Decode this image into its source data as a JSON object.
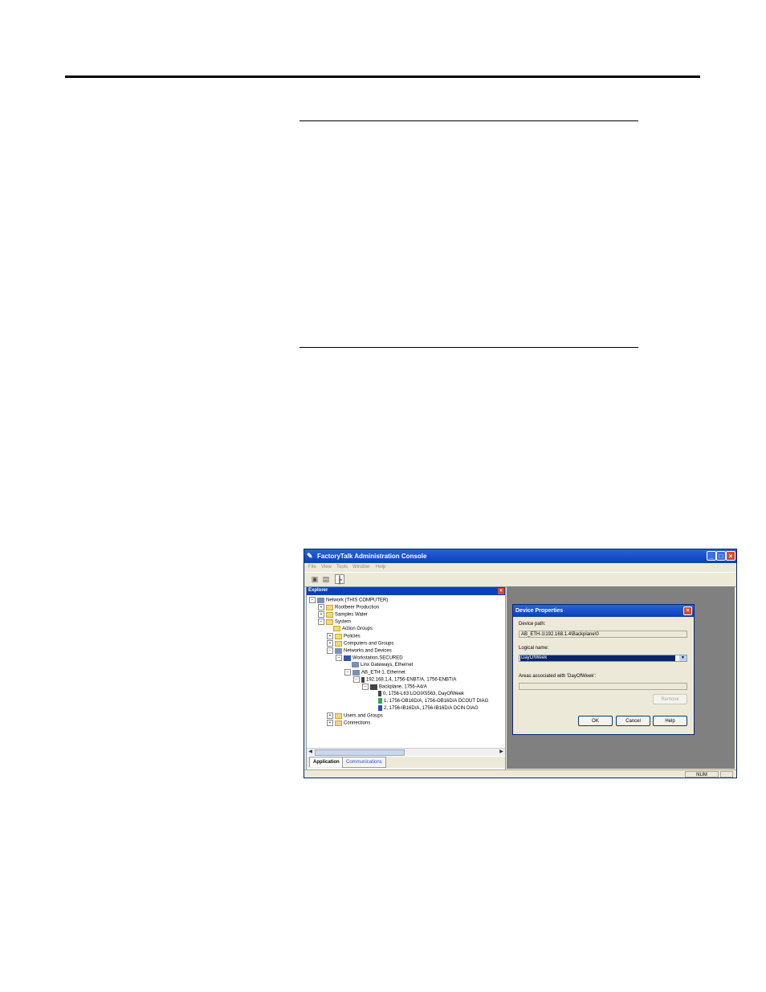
{
  "window": {
    "title": "FactoryTalk Administration Console",
    "controls": {
      "minimize": "_",
      "maximize": "□",
      "close": "×"
    }
  },
  "menu": [
    "File",
    "View",
    "Tools",
    "Window",
    "Help"
  ],
  "toolbar": {
    "icons": [
      "save-icon",
      "print-icon",
      "tree-icon"
    ]
  },
  "explorer": {
    "title": "Explorer",
    "tree": [
      {
        "label": "Network (THIS COMPUTER)",
        "expander": "−",
        "icon": "network"
      },
      {
        "label": "Rootbeer Production",
        "expander": "+",
        "icon": "app"
      },
      {
        "label": "Samples Water",
        "expander": "+",
        "icon": "app"
      },
      {
        "label": "System",
        "expander": "−",
        "icon": "folder"
      },
      {
        "label": "Action Groups",
        "expander": "",
        "icon": "folder"
      },
      {
        "label": "Policies",
        "expander": "+",
        "icon": "folder"
      },
      {
        "label": "Computers and Groups",
        "expander": "+",
        "icon": "folder"
      },
      {
        "label": "Networks and Devices",
        "expander": "−",
        "icon": "network"
      },
      {
        "label": "Workstation.SECURED",
        "expander": "−",
        "icon": "pc"
      },
      {
        "label": "Linx Gateways, Ethernet",
        "expander": "",
        "icon": "network"
      },
      {
        "label": "AB_ETH-1, Ethernet",
        "expander": "−",
        "icon": "network"
      },
      {
        "label": "192.168.1.4, 1756-ENBT/A, 1756-ENBT/A",
        "expander": "−",
        "icon": "device"
      },
      {
        "label": "Backplane, 1756-A4/A",
        "expander": "−",
        "icon": "device"
      },
      {
        "label": "0, 1756-L63 LOGIX5563, DayOfWeek",
        "expander": "",
        "icon": "device",
        "selected": true
      },
      {
        "label": "1, 1756-OB16D/A, 1756-OB16D/A  DCOUT DIAG",
        "expander": "",
        "icon": "green"
      },
      {
        "label": "2, 1756-IB16D/A, 1756-IB16D/A  DCIN  DIAG",
        "expander": "",
        "icon": "blue"
      },
      {
        "label": "Users and Groups",
        "expander": "+",
        "icon": "folder"
      },
      {
        "label": "Connections",
        "expander": "+",
        "icon": "folder"
      }
    ],
    "tabs": [
      "Application",
      "Communications"
    ]
  },
  "dialog": {
    "title": "Device Properties",
    "device_path_label": "Device path:",
    "device_path": "AB_ETH-1\\192.168.1.4\\Backplane\\0",
    "logical_name_label": "Logical name:",
    "logical_name": "DayOfWeek",
    "areas_label": "Areas associated with 'DayOfWeek':",
    "areas_value": "",
    "remove_button": "Remove",
    "ok_button": "OK",
    "cancel_button": "Cancel",
    "help_button": "Help"
  },
  "statusbar": {
    "num": "NUM"
  }
}
